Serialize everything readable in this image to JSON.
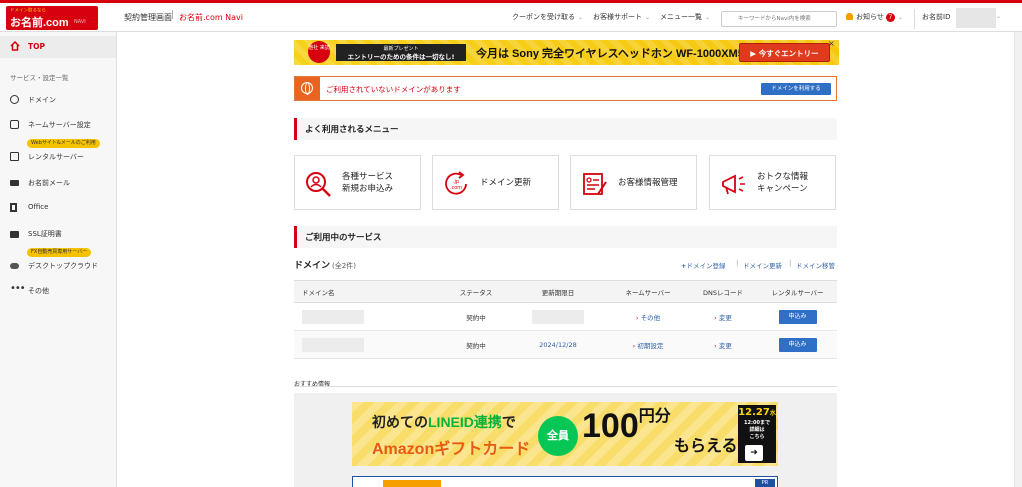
{
  "header": {
    "logo_tagline": "ドメイン取るなら",
    "logo_name": "お名前.com",
    "logo_sub": "NAVI",
    "nav_home": "契約管理画面",
    "nav_sep": "|",
    "nav_brand": "お名前.com Navi",
    "menu_coupon": "クーポンを受け取る",
    "menu_support": "お客様サポート",
    "menu_list": "メニュー一覧",
    "search_placeholder": "キーワードからNavi内を検索",
    "notice_label": "お知らせ",
    "notice_count": "7",
    "user_id_label": "お名前ID",
    "accent_color": "#d7000f"
  },
  "sidebar": {
    "top_label": "TOP",
    "section_label": "サービス・設定一覧",
    "items": [
      {
        "label": "ドメイン"
      },
      {
        "label": "ネームサーバー設定"
      },
      {
        "label": "レンタルサーバー",
        "pill": "Webサイト&メールのご利用"
      },
      {
        "label": "お名前メール"
      },
      {
        "label": "Office"
      },
      {
        "label": "SSL証明書"
      },
      {
        "label": "デスクトップクラウド",
        "pill": "FX自動売買専用サーバー"
      },
      {
        "label": "その他"
      }
    ]
  },
  "promo": {
    "seal": "他社\n来訪",
    "box_line1": "最新プレゼント",
    "box_line2": "エントリーのための条件は一切なし!",
    "main_text": "今月は Sony 完全ワイヤレスヘッドホン WF-1000XM5",
    "button": "今すぐエントリー",
    "close": "×"
  },
  "alert": {
    "text": "ご利用されていないドメインがあります",
    "button": "ドメインを利用する"
  },
  "frequent": {
    "heading": "よく利用されるメニュー",
    "cards": [
      {
        "line1": "各種サービス",
        "line2": "新規お申込み",
        "icon": "search-person-icon"
      },
      {
        "line1": "ドメイン更新",
        "line2": "",
        "icon": "domain-renew-icon"
      },
      {
        "line1": "お客様情報管理",
        "line2": "",
        "icon": "customer-info-icon"
      },
      {
        "line1": "おトクな情報",
        "line2": "キャンペーン",
        "icon": "megaphone-icon"
      }
    ]
  },
  "services": {
    "heading": "ご利用中のサービス",
    "domain_title": "ドメイン",
    "domain_count": "(全2件)",
    "link_register": "ドメイン登録",
    "link_renew": "ドメイン更新",
    "link_transfer": "ドメイン移管",
    "columns": [
      "ドメイン名",
      "ステータス",
      "更新期限日",
      "ネームサーバー",
      "DNSレコード",
      "レンタルサーバー"
    ],
    "rows": [
      {
        "status": "契約中",
        "expiry": "",
        "nameserver": "その他",
        "dns": "変更",
        "rental": "申込み"
      },
      {
        "status": "契約中",
        "expiry": "2024/12/28",
        "nameserver": "初期設定",
        "dns": "変更",
        "rental": "申込み"
      }
    ]
  },
  "recommend": {
    "heading": "おすすめ情報",
    "line_t1a": "初めての",
    "line_t1b": "LINEID連携",
    "line_t1c": "で",
    "line_t2": "Amazonギフトカード",
    "line_all": "全員",
    "line_amount": "100",
    "line_unit": "円分",
    "line_get": "もらえる",
    "deadline": "12.27",
    "deadline_day": "水",
    "deadline_time": "12:00まで",
    "deadline_detail": "詳細は\nこちら",
    "pr": "PR"
  }
}
